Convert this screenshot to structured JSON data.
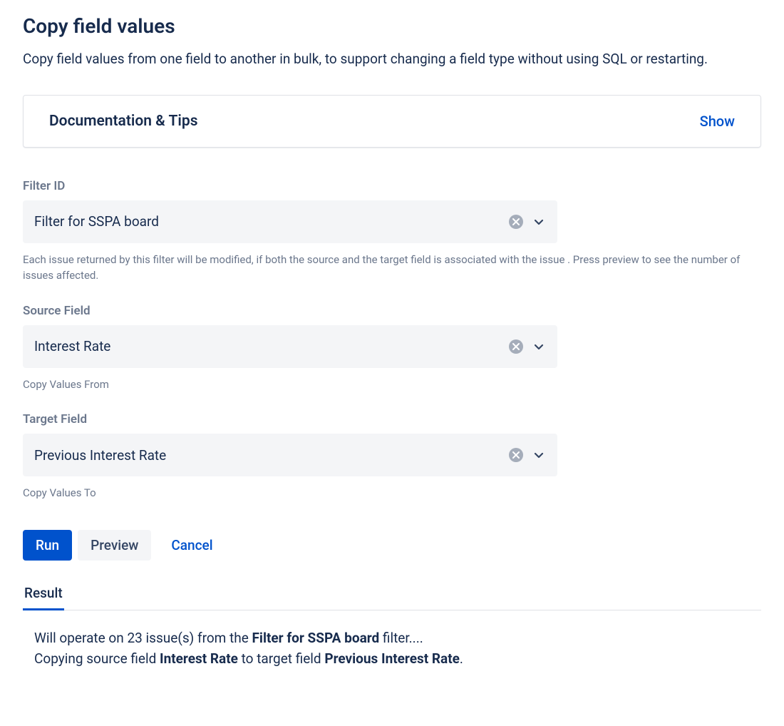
{
  "header": {
    "title": "Copy field values",
    "description": "Copy field values from one field to another in bulk, to support changing a field type without using SQL or restarting."
  },
  "docPanel": {
    "title": "Documentation & Tips",
    "action": "Show"
  },
  "fields": {
    "filter": {
      "label": "Filter ID",
      "value": "Filter for SSPA board",
      "help": "Each issue returned by this filter will be modified, if both the source and the target field is associated with the issue . Press preview to see the number of issues affected."
    },
    "source": {
      "label": "Source Field",
      "value": "Interest Rate",
      "help": "Copy Values From"
    },
    "target": {
      "label": "Target Field",
      "value": "Previous Interest Rate",
      "help": "Copy Values To"
    }
  },
  "buttons": {
    "run": "Run",
    "preview": "Preview",
    "cancel": "Cancel"
  },
  "result": {
    "tabLabel": "Result",
    "issueCount": "23",
    "filterName": "Filter for SSPA board",
    "sourceField": "Interest Rate",
    "targetField": "Previous Interest Rate",
    "line1_pre": "Will operate on ",
    "line1_mid": " issue(s) from the ",
    "line1_post": " filter....",
    "line2_pre": "Copying source field ",
    "line2_mid": " to target field ",
    "line2_post": "."
  }
}
